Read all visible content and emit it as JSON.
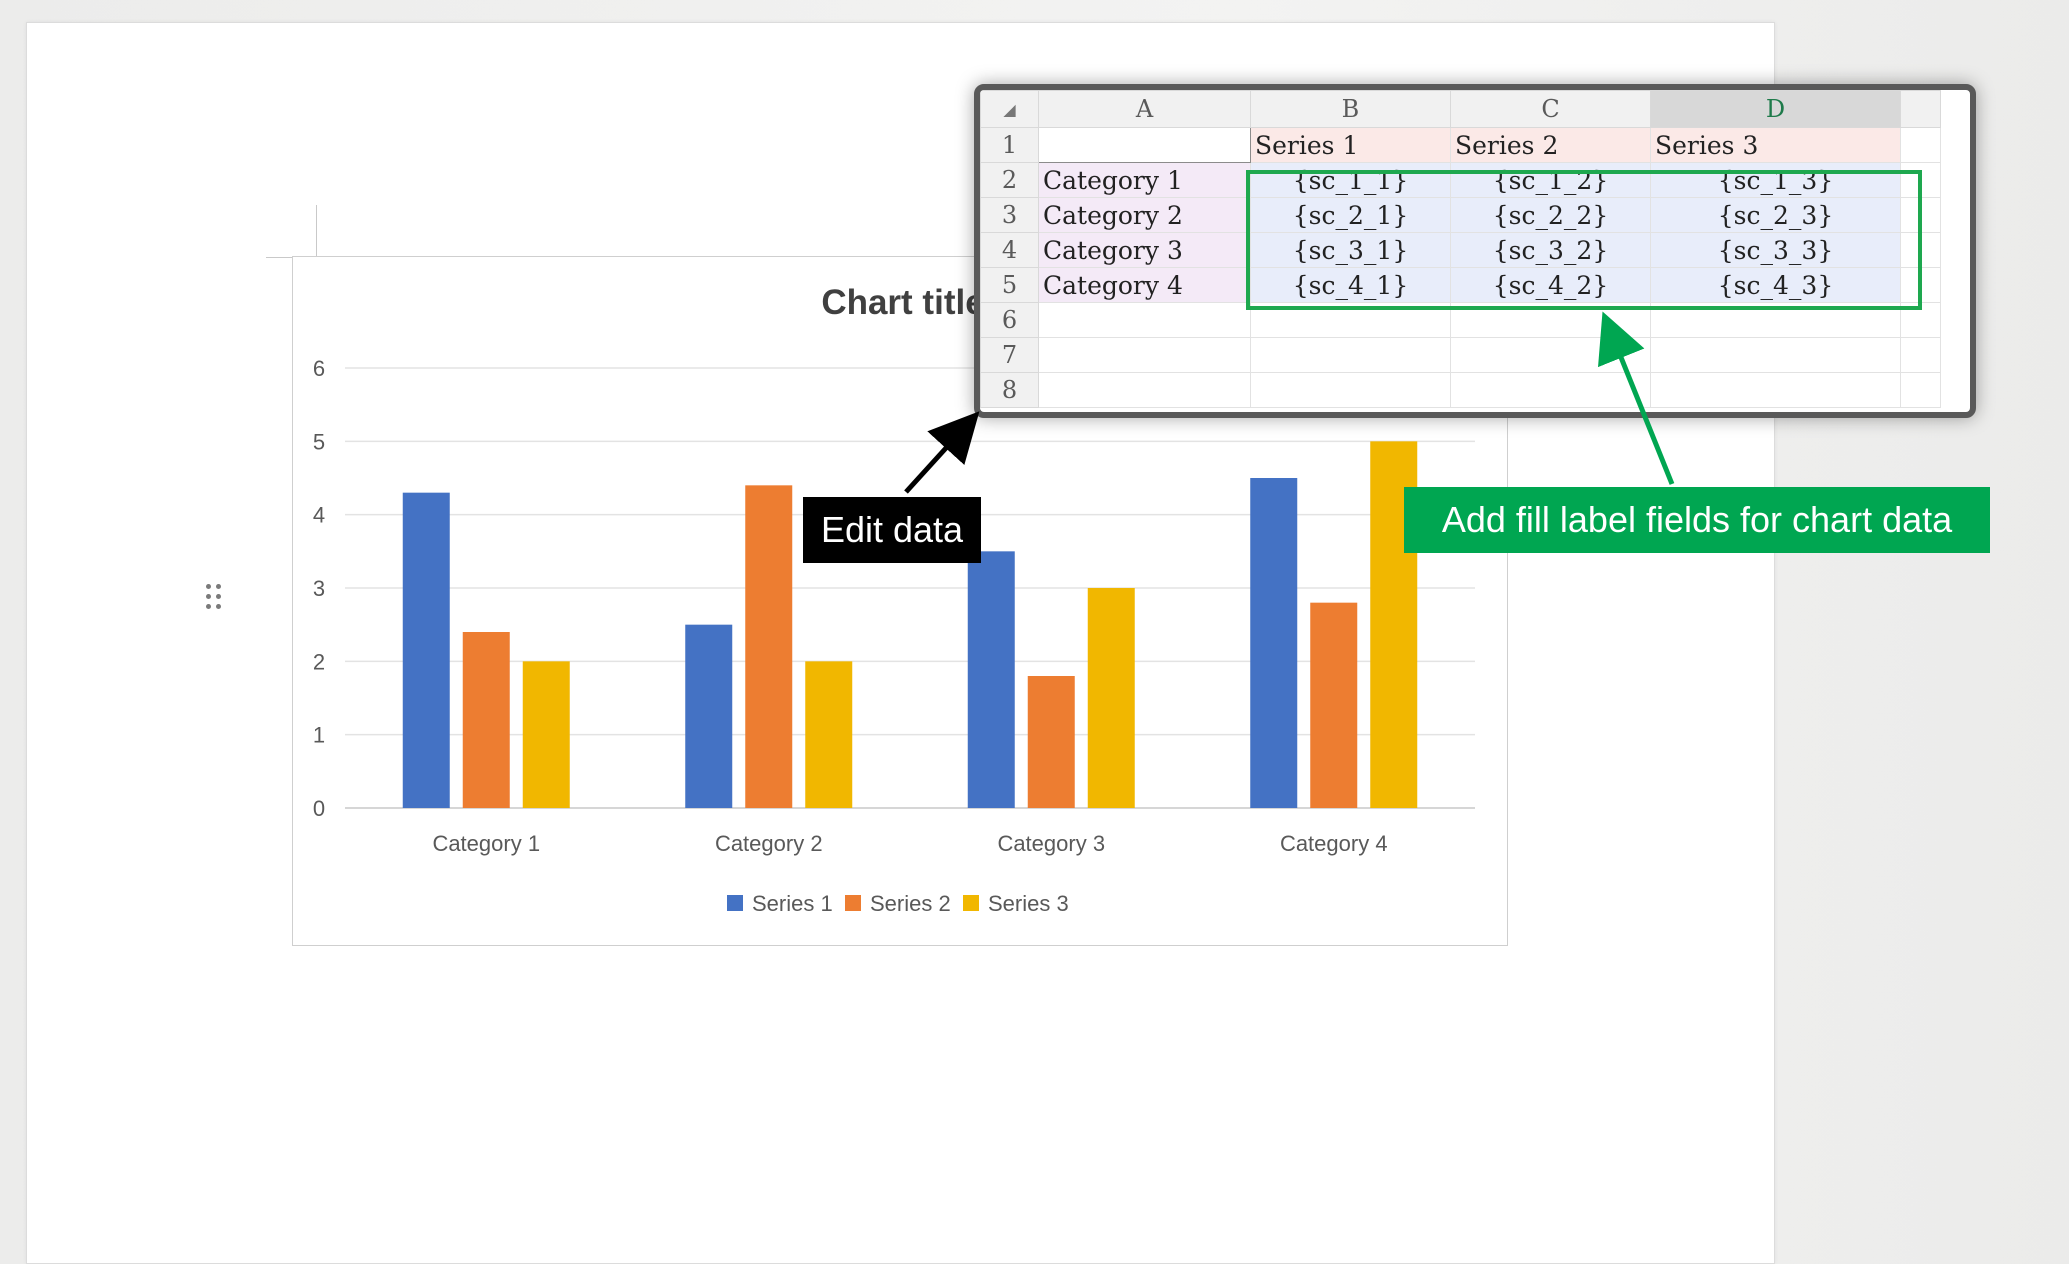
{
  "chart_data": {
    "type": "bar",
    "title": "Chart title",
    "categories": [
      "Category 1",
      "Category 2",
      "Category 3",
      "Category 4"
    ],
    "series": [
      {
        "name": "Series 1",
        "color": "#4472c4",
        "values": [
          4.3,
          2.5,
          3.5,
          4.5
        ]
      },
      {
        "name": "Series 2",
        "color": "#ed7d31",
        "values": [
          2.4,
          4.4,
          1.8,
          2.8
        ]
      },
      {
        "name": "Series 3",
        "color": "#f1b700",
        "values": [
          2,
          2,
          3,
          5
        ]
      }
    ],
    "ylim": [
      0,
      6
    ],
    "yticks": [
      "0",
      "1",
      "2",
      "3",
      "4",
      "5",
      "6"
    ],
    "grid": true,
    "legend_position": "bottom"
  },
  "sheet": {
    "corner_glyph": "◢",
    "columns": [
      "A",
      "B",
      "C",
      "D"
    ],
    "selected_column": "D",
    "rows": [
      {
        "num": "1",
        "cells": [
          "",
          "Series 1",
          "Series 2",
          "Series 3"
        ]
      },
      {
        "num": "2",
        "cells": [
          "Category 1",
          "{sc_1_1}",
          "{sc_1_2}",
          "{sc_1_3}"
        ]
      },
      {
        "num": "3",
        "cells": [
          "Category 2",
          "{sc_2_1}",
          "{sc_2_2}",
          "{sc_2_3}"
        ]
      },
      {
        "num": "4",
        "cells": [
          "Category 3",
          "{sc_3_1}",
          "{sc_3_2}",
          "{sc_3_3}"
        ]
      },
      {
        "num": "5",
        "cells": [
          "Category 4",
          "{sc_4_1}",
          "{sc_4_2}",
          "{sc_4_3}"
        ]
      },
      {
        "num": "6",
        "cells": [
          "",
          "",
          "",
          ""
        ]
      },
      {
        "num": "7",
        "cells": [
          "",
          "",
          "",
          ""
        ]
      },
      {
        "num": "8",
        "cells": [
          "",
          "",
          "",
          ""
        ]
      }
    ]
  },
  "callouts": {
    "edit_data": "Edit data",
    "add_fields": "Add fill label fields for chart data"
  },
  "icons": {
    "drag_handle": "drag-handle-icon",
    "edit_arrow_color": "#000000",
    "add_arrow_color": "#00a651"
  }
}
